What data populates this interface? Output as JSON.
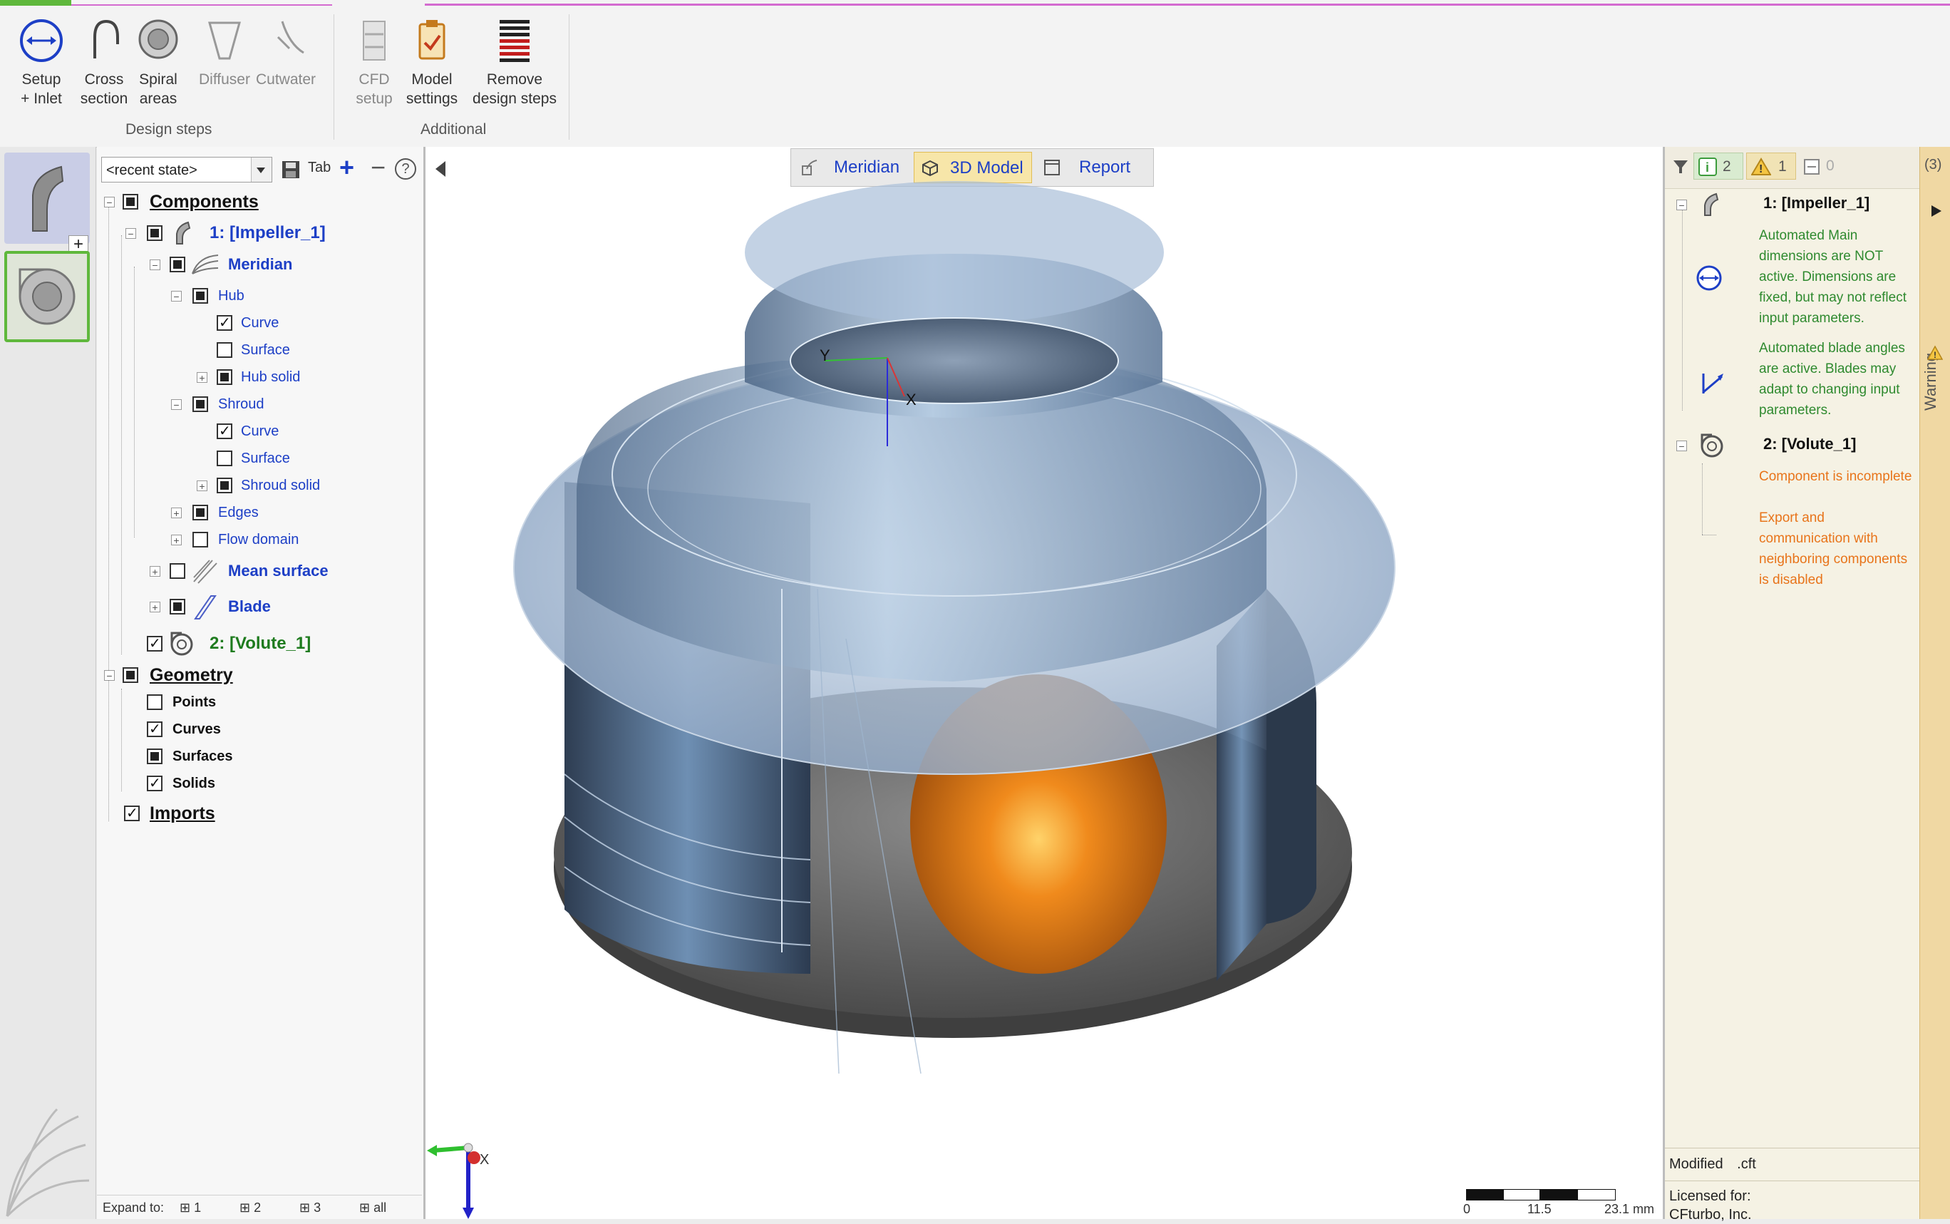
{
  "ribbon": {
    "design_buttons": [
      {
        "line1": "Setup",
        "line2": "+ Inlet",
        "icon": "setup-inlet-icon"
      },
      {
        "line1": "Cross",
        "line2": "section",
        "icon": "cross-section-icon"
      },
      {
        "line1": "Spiral",
        "line2": "areas",
        "icon": "spiral-areas-icon"
      },
      {
        "line1": "Diffuser",
        "line2": "",
        "icon": "diffuser-icon"
      },
      {
        "line1": "Cutwater",
        "line2": "",
        "icon": "cutwater-icon"
      }
    ],
    "design_group_label": "Design steps",
    "additional_buttons": [
      {
        "line1": "CFD",
        "line2": "setup",
        "icon": "cfd-setup-icon"
      },
      {
        "line1": "Model",
        "line2": "settings",
        "icon": "model-settings-icon"
      },
      {
        "line1": "Remove",
        "line2": "design steps",
        "icon": "remove-design-steps-icon"
      }
    ],
    "additional_group_label": "Additional"
  },
  "tree_toolbar": {
    "state_value": "<recent state>",
    "tab_label": "Tab",
    "plus": "+",
    "minus": "−",
    "help": "?"
  },
  "tree": {
    "components": "Components",
    "impeller": "1: [Impeller_1]",
    "meridian": "Meridian",
    "hub": "Hub",
    "hub_curve": "Curve",
    "hub_surface": "Surface",
    "hub_solid": "Hub solid",
    "shroud": "Shroud",
    "shroud_curve": "Curve",
    "shroud_surface": "Surface",
    "shroud_solid": "Shroud solid",
    "edges": "Edges",
    "flow_domain": "Flow domain",
    "mean_surface": "Mean surface",
    "blade": "Blade",
    "volute": "2: [Volute_1]",
    "geometry": "Geometry",
    "points": "Points",
    "curves": "Curves",
    "surfaces": "Surfaces",
    "solids": "Solids",
    "imports": "Imports"
  },
  "tree_footer": {
    "expand_to": "Expand to:",
    "levels": [
      "1",
      "2",
      "3",
      "all"
    ]
  },
  "viewport": {
    "tabs": [
      "Meridian",
      "3D Model",
      "Report"
    ],
    "active_tab": "3D Model",
    "axis_x": "X",
    "scale_labels": [
      "0",
      "11.5",
      "23.1 mm"
    ]
  },
  "messages": {
    "info_count": "2",
    "warning_count": "1",
    "other_count": "0",
    "side_count": "(3)",
    "side_tab_label": "Warning",
    "impeller_title": "1: [Impeller_1]",
    "impeller_msg1": [
      "Automated Main",
      "dimensions are NOT",
      "active. Dimensions are",
      "fixed, but may not reflect",
      "input parameters."
    ],
    "impeller_msg2": [
      "Automated blade angles",
      "are active. Blades may",
      "adapt to changing input",
      "parameters."
    ],
    "volute_title": "2: [Volute_1]",
    "volute_msg1": [
      "Component is incomplete"
    ],
    "volute_msg2": [
      "Export and",
      "communication with",
      "neighboring components",
      "is disabled"
    ]
  },
  "status": {
    "modified_label": "Modified",
    "file_ext": ".cft",
    "licensed": "Licensed for:",
    "company": "CFturbo, Inc."
  },
  "colors": {
    "tree_blue": "#1d3fc6",
    "volute_green": "#1e7b1e",
    "msg_green": "#2f8a2f",
    "msg_orange": "#e8741a",
    "active_tab": "#f7e6a9"
  }
}
